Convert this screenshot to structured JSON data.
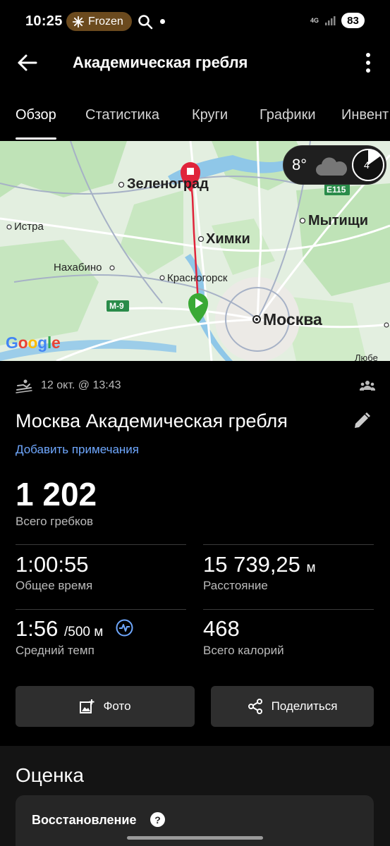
{
  "status": {
    "time": "10:25",
    "pill_label": "Frozen",
    "network": "4G",
    "battery": "83"
  },
  "header": {
    "title": "Академическая гребля"
  },
  "tabs": [
    {
      "label": "Обзор"
    },
    {
      "label": "Статистика"
    },
    {
      "label": "Круги"
    },
    {
      "label": "Графики"
    },
    {
      "label": "Инвент"
    }
  ],
  "map": {
    "places": [
      "Зеленоград",
      "Истра",
      "Мытищи",
      "Химки",
      "Нахабино",
      "Красногорск",
      "Москва",
      "Любе"
    ],
    "roads": [
      "E115",
      "M-9"
    ],
    "weather_temp": "8°",
    "weather_badge": "4",
    "attribution": "Google"
  },
  "activity": {
    "datetime": "12 окт. @ 13:43",
    "title": "Москва Академическая гребля",
    "add_note": "Добавить примечания",
    "strokes_value": "1 202",
    "strokes_label": "Всего гребков",
    "total_time_value": "1:00:55",
    "total_time_label": "Общее время",
    "distance_value": "15 739,25",
    "distance_unit": "м",
    "distance_label": "Расстояние",
    "pace_value": "1:56",
    "pace_unit": "/500 м",
    "pace_label": "Средний темп",
    "calories_value": "468",
    "calories_label": "Всего калорий"
  },
  "actions": {
    "photo": "Фото",
    "share": "Поделиться"
  },
  "assessment": {
    "title": "Оценка",
    "recovery": "Восстановление",
    "help": "?"
  },
  "colors": {
    "accent_link": "#6fa8ff",
    "route": "#e0243b",
    "start_marker": "#3aa935",
    "map_land": "#dfeedd",
    "map_water": "#8fc7e8"
  }
}
